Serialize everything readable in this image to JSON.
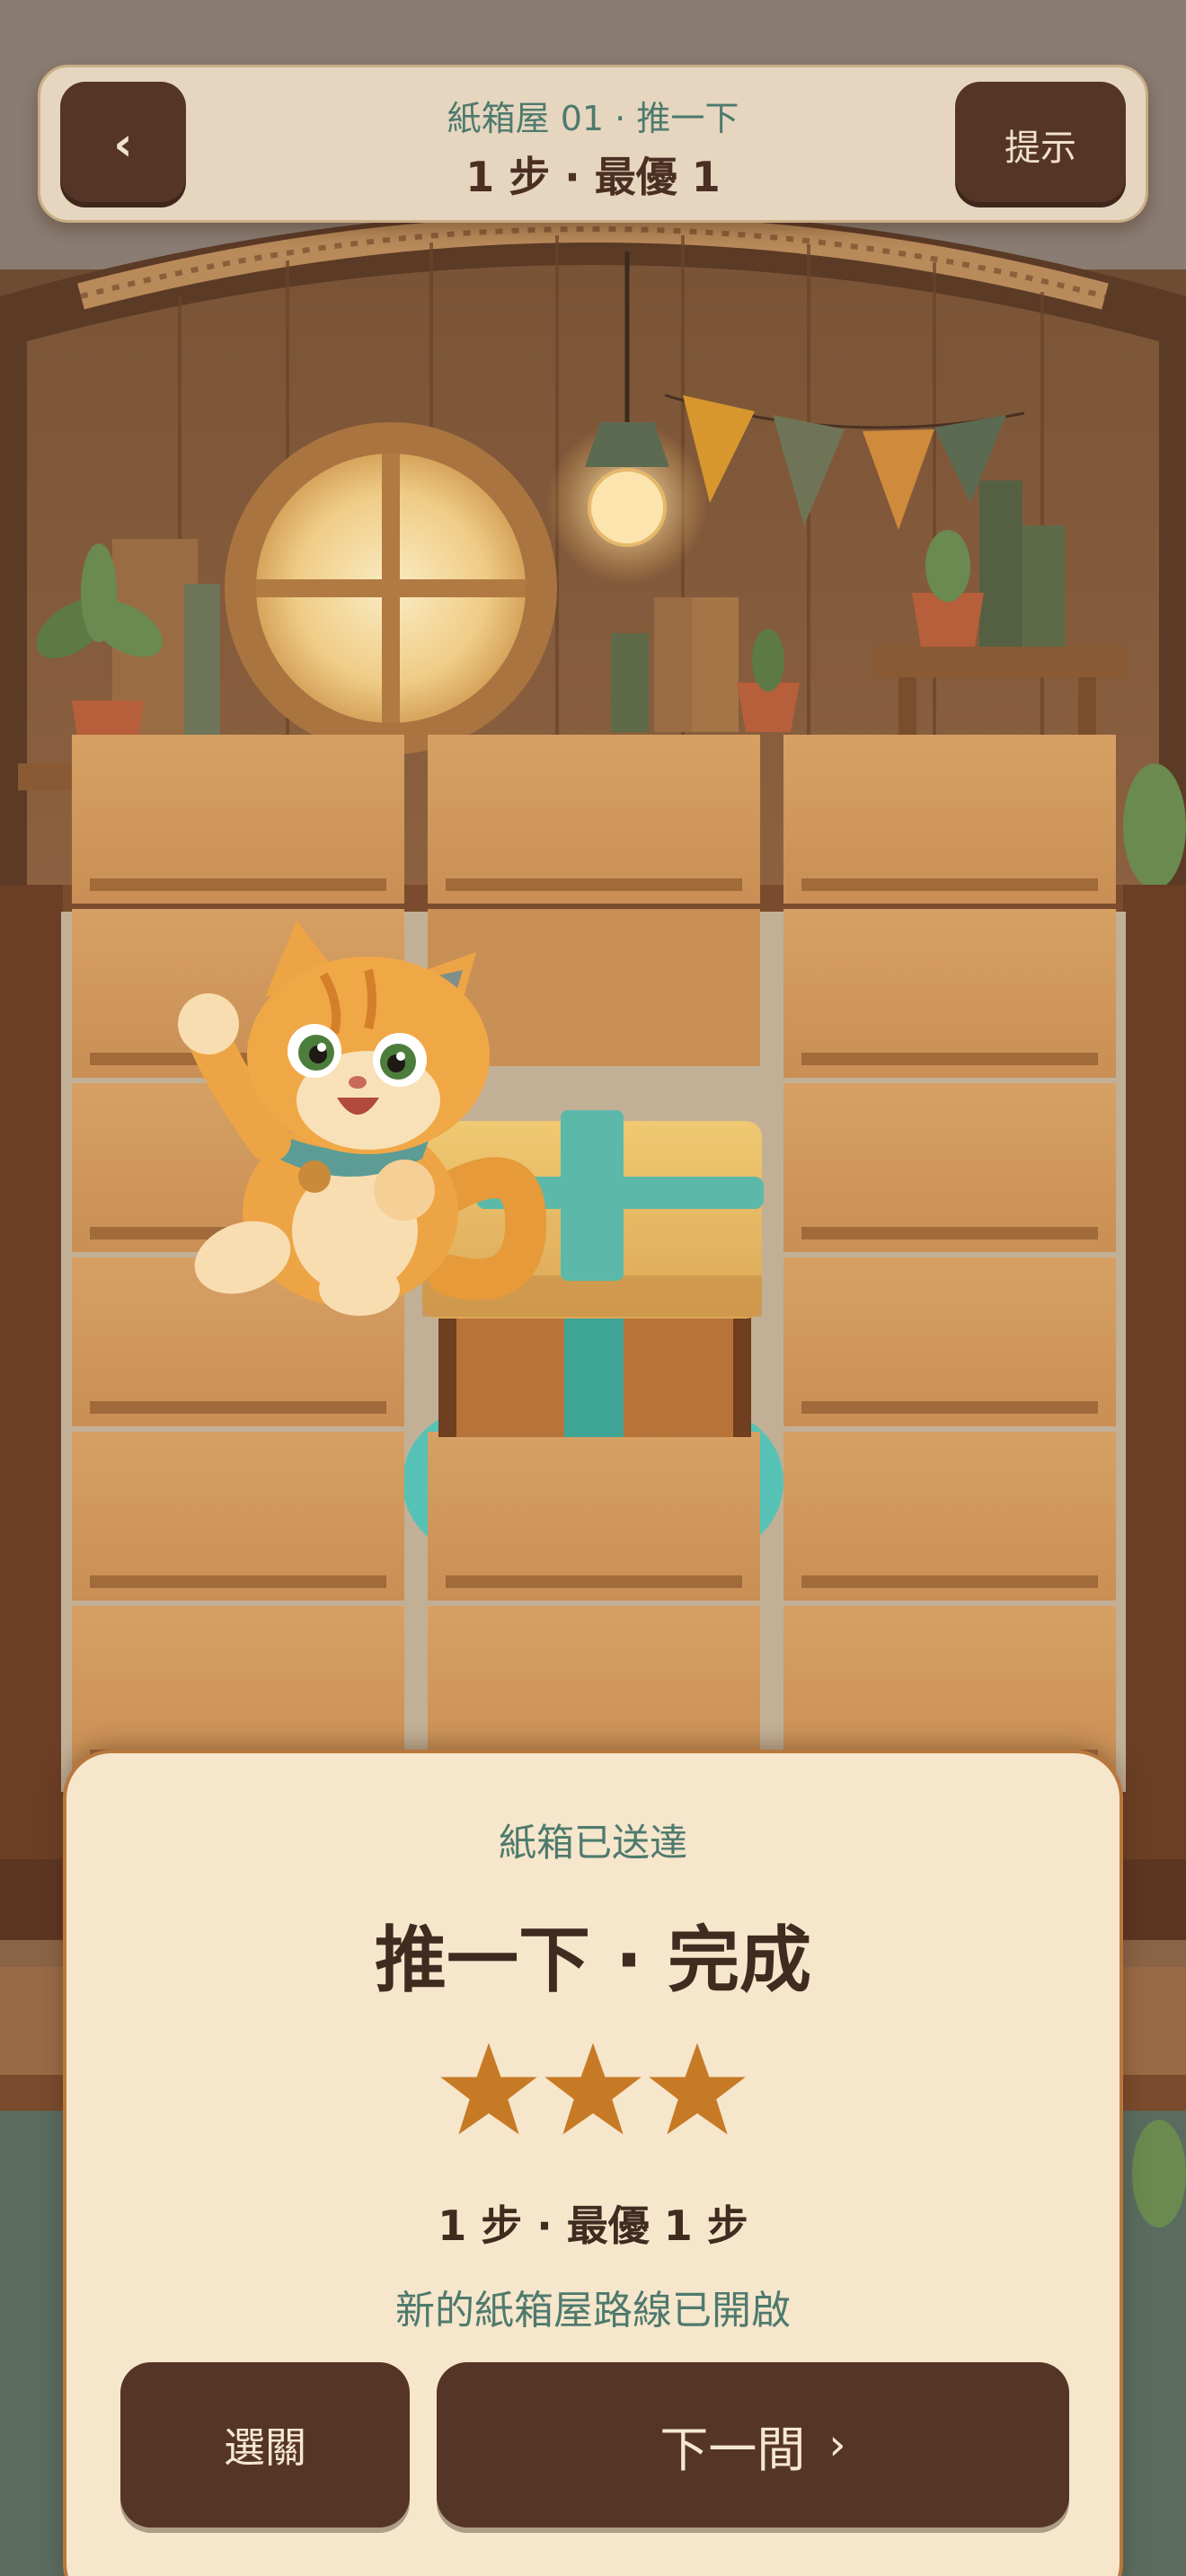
{
  "header": {
    "back_icon": "‹",
    "level_title": "紙箱屋 01 · 推一下",
    "steps": "1 步 · 最優 1",
    "hint_label": "提示"
  },
  "result": {
    "subtitle": "紙箱已送達",
    "title": "推一下 · 完成",
    "stars_earned": 3,
    "stars_total": 3,
    "steps": "1 步 · 最優 1 步",
    "unlock_message": "新的紙箱屋路線已開啟",
    "select_button": "選關",
    "next_button": "下一間",
    "next_icon": "›"
  },
  "colors": {
    "button_brown": "#553526",
    "accent_teal": "#4e7a6e",
    "star_orange": "#c77a25",
    "panel_cream": "#f6e6cb",
    "ribbon_teal": "#4fb3a5"
  },
  "icons": [
    "back-chevron-icon",
    "star-icon",
    "chevron-right-icon",
    "cat-character",
    "gift-box"
  ]
}
